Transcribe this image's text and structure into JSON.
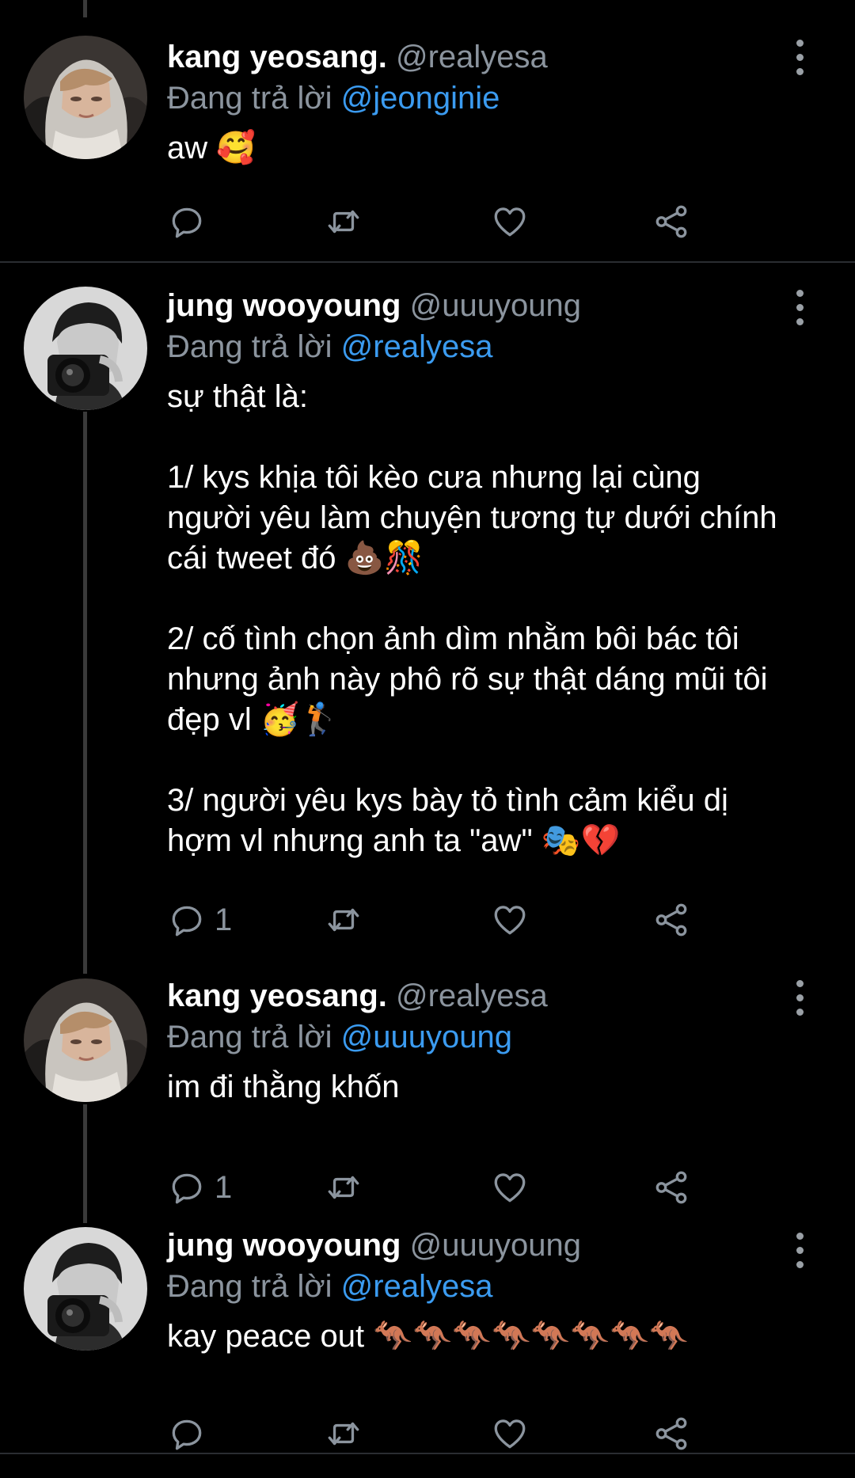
{
  "colors": {
    "background": "#000000",
    "text": "#ffffff",
    "muted": "#8b949e",
    "mention": "#3b9bf0",
    "divider": "#2a2d31",
    "thread": "#3a3a3a"
  },
  "icons": {
    "reply": "comment-bubble-icon",
    "retweet": "retweet-icon",
    "like": "heart-icon",
    "share": "share-icon",
    "more": "vertical-dots-icon"
  },
  "tweets": [
    {
      "name": "kang yeosang.",
      "handle": "@realyesa",
      "reply_prefix": "Đang trả lời",
      "reply_to": "@jeonginie",
      "text": "aw 🥰",
      "reply_count": ""
    },
    {
      "name": "jung wooyoung",
      "handle": "@uuuyoung",
      "reply_prefix": "Đang trả lời",
      "reply_to": "@realyesa",
      "text": "sự thật là:\n\n1/ kys khịa tôi kèo cưa nhưng lại cùng\nngười yêu làm chuyện tương tự dưới chính\ncái tweet đó 💩🎊\n\n2/ cố tình chọn ảnh dìm nhằm bôi bác tôi\nnhưng ảnh này phô rõ sự thật dáng mũi tôi\nđẹp vl 🥳🏌\n\n3/ người yêu kys bày tỏ tình cảm kiểu dị\nhợm vl nhưng anh ta \"aw\" 🎭💔",
      "reply_count": "1"
    },
    {
      "name": "kang yeosang.",
      "handle": "@realyesa",
      "reply_prefix": "Đang trả lời",
      "reply_to": "@uuuyoung",
      "text": "im đi thằng khốn",
      "reply_count": "1"
    },
    {
      "name": "jung wooyoung",
      "handle": "@uuuyoung",
      "reply_prefix": "Đang trả lời",
      "reply_to": "@realyesa",
      "text": "kay peace out 🦘🦘🦘🦘🦘🦘🦘🦘",
      "reply_count": ""
    }
  ]
}
